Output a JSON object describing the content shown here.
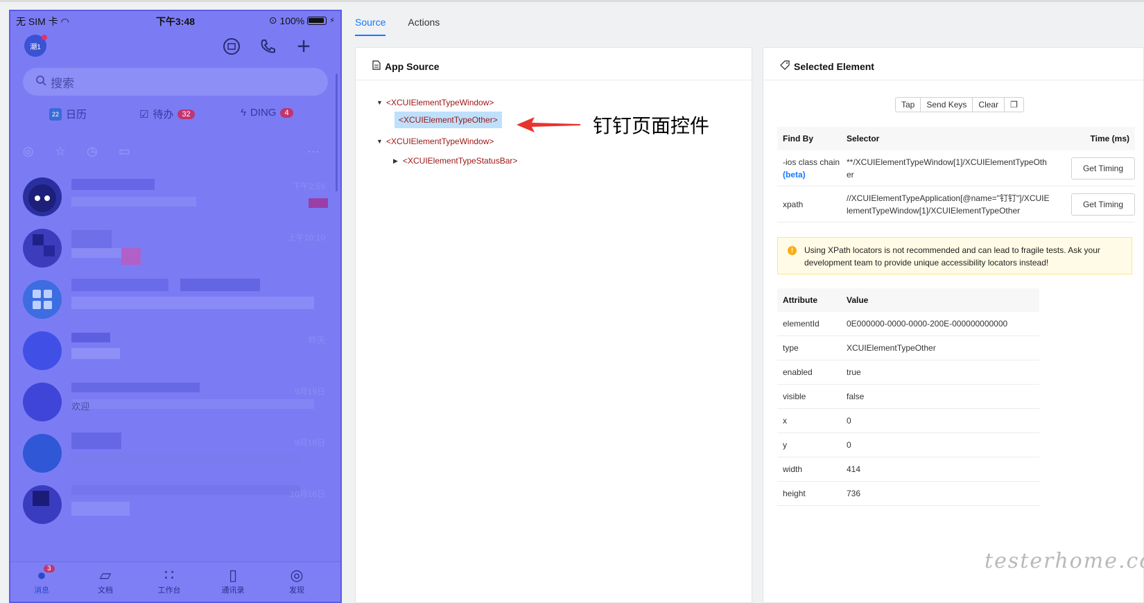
{
  "phone": {
    "status_left": "无 SIM 卡 ",
    "time": "下午3:48",
    "battery": "100%",
    "avatar_text": "潮1",
    "search_placeholder": "搜索",
    "quick": [
      {
        "label": "日历",
        "icon_text": "22"
      },
      {
        "label": "待办",
        "badge": "32"
      },
      {
        "label": "DING",
        "badge": "4"
      }
    ],
    "chat_times": [
      "下午2:59",
      "上午10:10",
      "",
      "昨天",
      "9月19日",
      "9月19日",
      "10月16日"
    ],
    "chat_snippet": "欢迎",
    "tabs": [
      {
        "label": "消息",
        "badge": "3"
      },
      {
        "label": "文档"
      },
      {
        "label": "工作台"
      },
      {
        "label": "通讯录"
      },
      {
        "label": "发现"
      }
    ]
  },
  "inspector": {
    "tabs": [
      "Source",
      "Actions"
    ],
    "app_source_title": "App Source",
    "tree": [
      "<XCUIElementTypeWindow>",
      "<XCUIElementTypeOther>",
      "<XCUIElementTypeWindow>",
      "<XCUIElementTypeStatusBar>"
    ],
    "annotation": "钉钉页面控件",
    "selected_title": "Selected Element",
    "actions": [
      "Tap",
      "Send Keys",
      "Clear"
    ],
    "find_table": {
      "headers": [
        "Find By",
        "Selector",
        "Time (ms)"
      ],
      "rows": [
        {
          "by": "-ios class chain",
          "beta": "(beta)",
          "selector_l1": "**/XCUIElementTypeWindow[1]/XCUIElementTypeOth",
          "selector_l2": "er",
          "button": "Get Timing"
        },
        {
          "by": "xpath",
          "beta": "",
          "selector_l1": "//XCUIElementTypeApplication[@name=\"钉钉\"]/XCUIE",
          "selector_l2": "lementTypeWindow[1]/XCUIElementTypeOther",
          "button": "Get Timing"
        }
      ]
    },
    "warning_l1": "Using XPath locators is not recommended and can lead to fragile tests. Ask your",
    "warning_l2": "development team to provide unique accessibility locators instead!",
    "attr_table": {
      "headers": [
        "Attribute",
        "Value"
      ],
      "rows": [
        {
          "attr": "elementId",
          "value": "0E000000-0000-0000-200E-000000000000"
        },
        {
          "attr": "type",
          "value": "XCUIElementTypeOther"
        },
        {
          "attr": "enabled",
          "value": "true"
        },
        {
          "attr": "visible",
          "value": "false"
        },
        {
          "attr": "x",
          "value": "0"
        },
        {
          "attr": "y",
          "value": "0"
        },
        {
          "attr": "width",
          "value": "414"
        },
        {
          "attr": "height",
          "value": "736"
        }
      ]
    }
  },
  "watermark": "testerhome.com"
}
